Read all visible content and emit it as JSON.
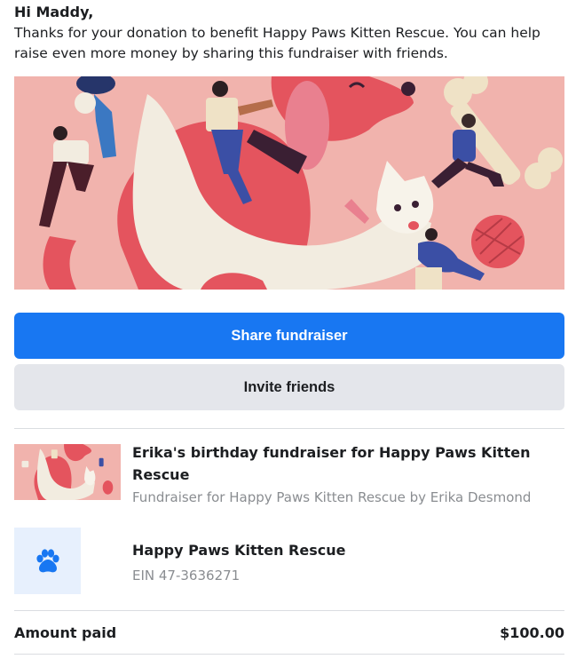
{
  "greeting": "Hi Maddy,",
  "message": "Thanks for your donation to benefit Happy Paws Kitten Rescue. You can help raise even more money by sharing this fundraiser with friends.",
  "hero_image": "dogs-and-people-illustration",
  "buttons": {
    "share_label": "Share fundraiser",
    "invite_label": "Invite friends"
  },
  "fundraiser": {
    "title": "Erika's birthday fundraiser for Happy Paws Kitten Rescue",
    "subtitle": "Fundraiser for Happy Paws Kitten Rescue by Erika Desmond",
    "thumbnail": "dogs-and-people-illustration"
  },
  "organization": {
    "name": "Happy Paws Kitten Rescue",
    "ein": "EIN 47-3636271",
    "icon": "paw-icon"
  },
  "payment": {
    "label": "Amount paid",
    "value": "$100.00"
  },
  "colors": {
    "primary": "#1877f2",
    "secondary": "#e4e6eb",
    "muted_text": "#8a8d91",
    "hero_bg": "#f1b3ad"
  }
}
